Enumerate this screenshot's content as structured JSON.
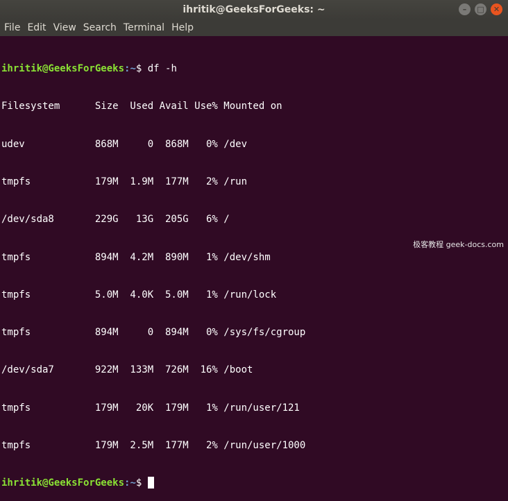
{
  "window": {
    "title": "ihritik@GeeksForGeeks: ~",
    "controls": {
      "minimize": "–",
      "maximize": "□",
      "close": "✕"
    }
  },
  "menu": [
    "File",
    "Edit",
    "View",
    "Search",
    "Terminal",
    "Help"
  ],
  "terminal": {
    "prompt_user": "ihritik@GeeksForGeeks",
    "prompt_path": ":~",
    "prompt_suffix": "$ ",
    "command": "df -h",
    "header": "Filesystem      Size  Used Avail Use% Mounted on",
    "rows": [
      "udev            868M     0  868M   0% /dev",
      "tmpfs           179M  1.9M  177M   2% /run",
      "/dev/sda8       229G   13G  205G   6% /",
      "tmpfs           894M  4.2M  890M   1% /dev/shm",
      "tmpfs           5.0M  4.0K  5.0M   1% /run/lock",
      "tmpfs           894M     0  894M   0% /sys/fs/cgroup",
      "/dev/sda7       922M  133M  726M  16% /boot",
      "tmpfs           179M   20K  179M   1% /run/user/121",
      "tmpfs           179M  2.5M  177M   2% /run/user/1000"
    ]
  },
  "watermark": "极客教程 geek-docs.com",
  "colors": {
    "terminal_bg": "#300a24",
    "prompt_user": "#8ae234",
    "prompt_path": "#729fcf",
    "close_button": "#e9541f"
  }
}
